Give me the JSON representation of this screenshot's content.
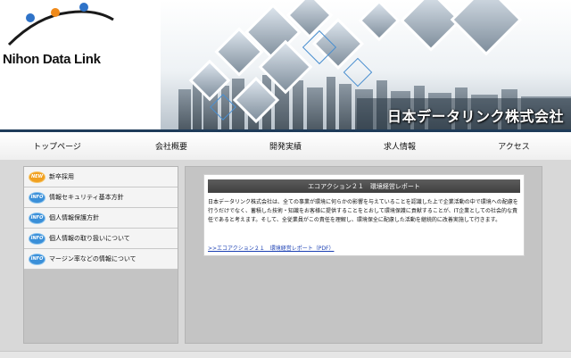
{
  "header": {
    "logo_text": "Nihon Data Link",
    "company_name": "日本データリンク株式会社"
  },
  "nav": {
    "items": [
      {
        "label": "トップページ"
      },
      {
        "label": "会社概要"
      },
      {
        "label": "開発実績"
      },
      {
        "label": "求人情報"
      },
      {
        "label": "アクセス"
      }
    ]
  },
  "sidebar": {
    "items": [
      {
        "badge": "NEW",
        "label": "新卒採用",
        "icon": "new-badge-icon"
      },
      {
        "badge": "INFO",
        "label": "情報セキュリティ基本方針",
        "icon": "info-badge-icon"
      },
      {
        "badge": "INFO",
        "label": "個人情報保護方針",
        "icon": "info-badge-icon"
      },
      {
        "badge": "INFO",
        "label": "個人情報の取り扱いについて",
        "icon": "info-badge-icon"
      },
      {
        "badge": "INFO",
        "label": "マージン率などの情報について",
        "icon": "info-badge-icon"
      }
    ]
  },
  "main": {
    "card": {
      "title": "エコアクション２１　環境経営レポート",
      "body": "日本データリンク株式会社は、全ての事業が環境に何らかの影響を与えていることを認識した上で企業活動の中で環境への配慮を行うだけでなく、蓄積した技術・知識をお客様に提供することをとおして環境保護に貢献することが、IT企業としての社会的な責任であると考えます。そして、全従業員がこの責任を理解し、環境保全に配慮した活動を継続的に改善実施して行きます。",
      "link": ">>エコアクション２１　環境経営レポート（PDF）"
    }
  },
  "colors": {
    "nav_border": "#1f3c5a",
    "link": "#1a3fb3",
    "card_title_bg": "#4a4a4a",
    "new_badge": "#f0a020",
    "info_badge": "#3a8fd8"
  }
}
